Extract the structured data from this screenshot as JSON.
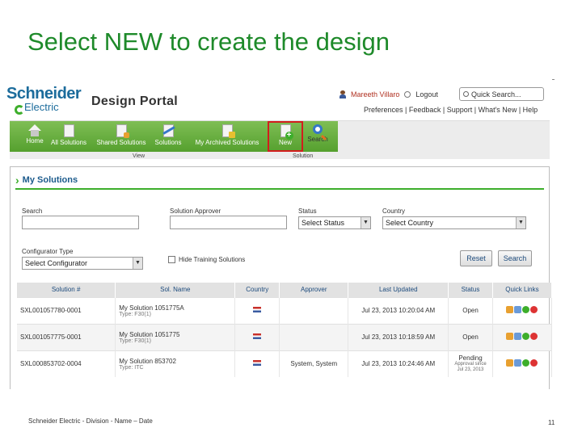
{
  "slide": {
    "title": "Select NEW to create the design",
    "footer_left": "Schneider Electric - Division - Name – Date",
    "page_number": "11"
  },
  "portal": {
    "logo_top": "Schneider",
    "logo_bottom": "Electric",
    "title": "Design Portal",
    "user_name": "Mareeth Villaro",
    "logout_label": "Logout",
    "quick_search_placeholder": "Quick Search...",
    "top_links": "Preferences | Feedback | Support | What's New | Help"
  },
  "nav": {
    "items": [
      {
        "label": "Home",
        "icon": "home-icon"
      },
      {
        "label": "All Solutions",
        "icon": "document-icon"
      },
      {
        "label": "Shared Solutions",
        "icon": "shared-document-icon"
      },
      {
        "label": "Solutions",
        "icon": "tools-document-icon"
      },
      {
        "label": "My Archived Solutions",
        "icon": "archive-document-icon"
      },
      {
        "label": "New",
        "icon": "new-document-icon"
      },
      {
        "label": "Search",
        "icon": "search-icon"
      }
    ],
    "sub_view": "View",
    "sub_solution": "Solution",
    "highlight_color": "#d21d1d"
  },
  "panel": {
    "title": "My Solutions",
    "search_label": "Search",
    "approver_label": "Solution Approver",
    "status_label": "Status",
    "status_value": "Select Status",
    "country_label": "Country",
    "country_value": "Select Country",
    "configurator_label": "Configurator Type",
    "configurator_value": "Select Configurator",
    "hide_training_label": "Hide Training Solutions",
    "reset_label": "Reset",
    "search_button_label": "Search"
  },
  "table": {
    "headers": [
      "Solution #",
      "Sol. Name",
      "Country",
      "Approver",
      "Last Updated",
      "Status",
      "Quick Links"
    ],
    "rows": [
      {
        "id": "SXL001057780-0001",
        "name": "My Solution 1051775A",
        "type": "Type: F30(1)",
        "approver": "",
        "updated": "Jul 23, 2013 10:20:04 AM",
        "status": "Open",
        "status_sub": ""
      },
      {
        "id": "SXL001057775-0001",
        "name": "My Solution 1051775",
        "type": "Type: F30(1)",
        "approver": "",
        "updated": "Jul 23, 2013 10:18:59 AM",
        "status": "Open",
        "status_sub": ""
      },
      {
        "id": "SXL000853702-0004",
        "name": "My Solution 853702",
        "type": "Type: ITC",
        "approver": "System, System",
        "updated": "Jul 23, 2013 10:24:46 AM",
        "status": "Pending",
        "status_sub": "Approval since Jul 23, 2013"
      }
    ]
  },
  "colors": {
    "title_green": "#1e8a2a",
    "brand_blue": "#1c6c9c",
    "nav_green": "#55a02e"
  }
}
